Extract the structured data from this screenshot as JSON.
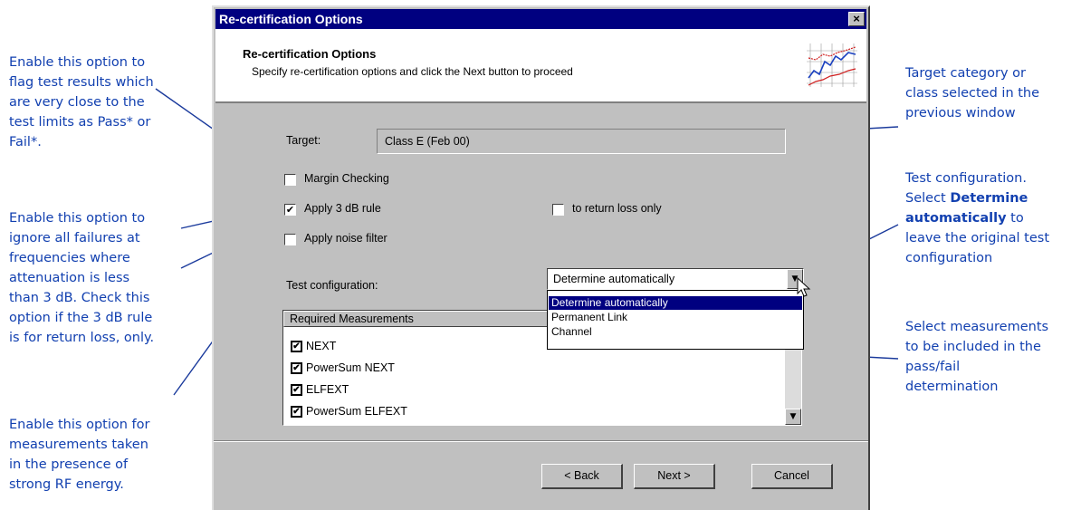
{
  "annotations": {
    "margin_checking_line1": "Enable this option to",
    "margin_checking_line2": "flag test results which",
    "margin_checking_line3": "are very close to the",
    "margin_checking_line4": "test limits as Pass* or",
    "margin_checking_line5": "Fail*.",
    "apply3db_line1": "Enable this option to",
    "apply3db_line2": "ignore all failures at",
    "apply3db_line3": "frequencies where",
    "apply3db_line4": "attenuation is less",
    "apply3db_line5": "than 3 dB. Check this",
    "apply3db_line6": "option if the 3 dB rule",
    "apply3db_line7": "is for return loss, only.",
    "noise_line1": "Enable this option for",
    "noise_line2": "measurements taken",
    "noise_line3": "in the presence of",
    "noise_line4": "strong RF energy.",
    "target_line1": "Target category or",
    "target_line2": "class selected in the",
    "target_line3": "previous window",
    "testconfig_line1": "Test configuration.",
    "testconfig_line2a": "Select ",
    "testconfig_line2b": "Determine",
    "testconfig_line3a": "automatically",
    "testconfig_line3b": " to",
    "testconfig_line4": "leave the original test",
    "testconfig_line5": "configuration",
    "measure_line1": "Select measurements",
    "measure_line2": "to be included in the",
    "measure_line3": "pass/fail",
    "measure_line4": "determination"
  },
  "dialog": {
    "title": "Re-certification Options",
    "close_glyph": "×",
    "header_title": "Re-certification Options",
    "header_subtitle": "Specify re-certification options and click the Next button to proceed",
    "target_label": "Target:",
    "target_value": "Class E (Feb 00)",
    "margin_checking_label": "Margin Checking",
    "margin_checking_checked": false,
    "apply3db_label": "Apply 3 dB rule",
    "apply3db_checked": true,
    "return_loss_label": "to return loss only",
    "return_loss_checked": false,
    "noise_filter_label": "Apply noise filter",
    "noise_filter_checked": false,
    "test_config_label": "Test configuration:",
    "test_config_value": "Determine automatically",
    "test_config_options": [
      "Determine automatically",
      "Permanent Link",
      "Channel"
    ],
    "required_header": "Required Measurements",
    "measurements": [
      "NEXT",
      "PowerSum NEXT",
      "ELFEXT",
      "PowerSum ELFEXT"
    ],
    "back_label": "< Back",
    "next_label": "Next >",
    "cancel_label": "Cancel",
    "check_glyph": "✔",
    "arrow_glyph": "▼"
  },
  "colors": {
    "annotation_text": "#1240b0",
    "titlebar": "#000080",
    "dialog_face": "#c0c0c0",
    "selection": "#000080",
    "leader_line": "#1a3a9c"
  },
  "icons": [
    "close-icon",
    "chevron-down-icon",
    "check-icon",
    "chart-logo-icon",
    "mouse-cursor-icon"
  ]
}
